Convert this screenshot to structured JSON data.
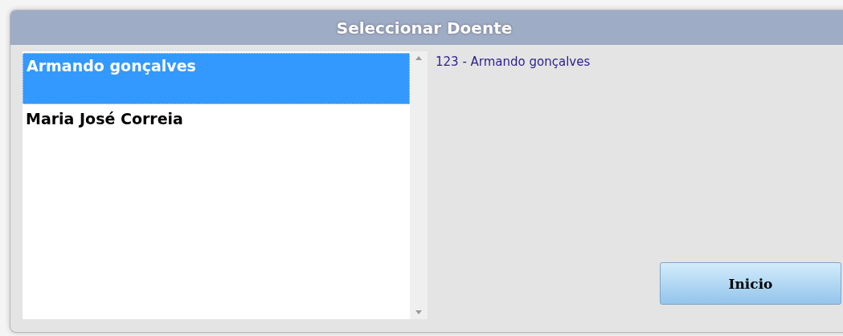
{
  "dialog": {
    "title": "Seleccionar Doente"
  },
  "patients": [
    {
      "name": "Armando gonçalves",
      "selected": true
    },
    {
      "name": "Maria José Correia",
      "selected": false
    }
  ],
  "detail": "123 - Armando gonçalves",
  "button": "Inicio"
}
